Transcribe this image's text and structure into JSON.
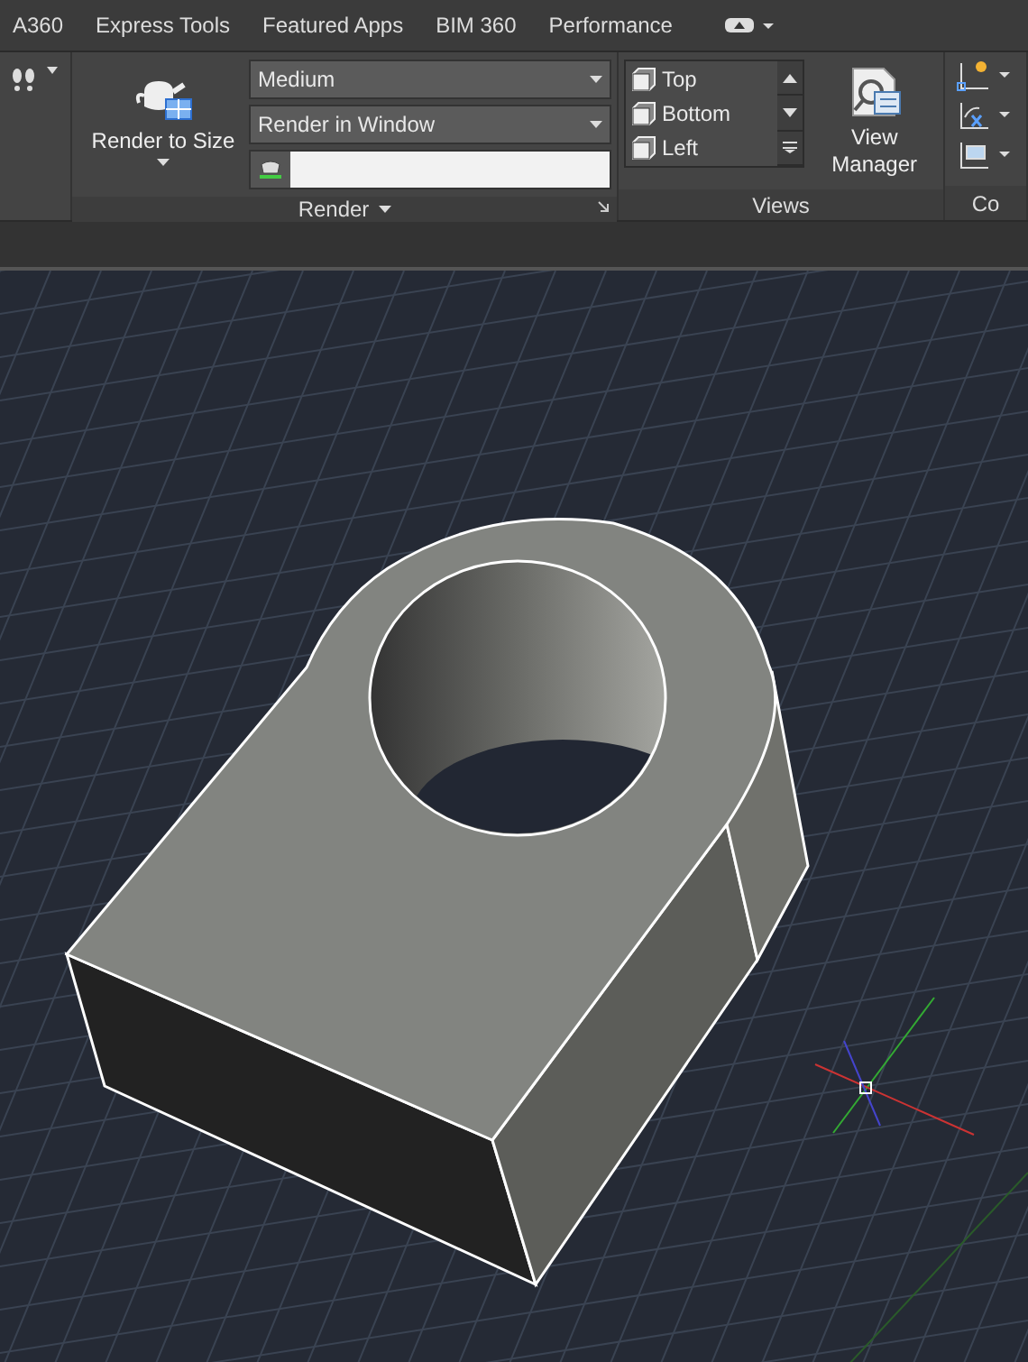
{
  "ribbon_tabs": [
    {
      "label": "A360",
      "selected": false
    },
    {
      "label": "Express Tools",
      "selected": false
    },
    {
      "label": "Featured Apps",
      "selected": false
    },
    {
      "label": "BIM 360",
      "selected": false
    },
    {
      "label": "Performance",
      "selected": false
    }
  ],
  "render_panel": {
    "button": "Render to Size",
    "preset": "Medium",
    "output": "Render in Window",
    "title": "Render"
  },
  "views_panel": {
    "views": [
      {
        "label": "Top"
      },
      {
        "label": "Bottom"
      },
      {
        "label": "Left"
      }
    ],
    "button": "View Manager",
    "title": "Views"
  },
  "coordinates_panel": {
    "title": "Co"
  }
}
